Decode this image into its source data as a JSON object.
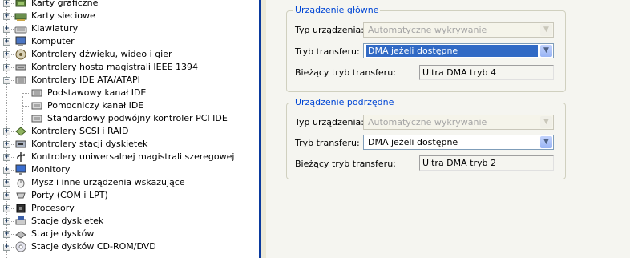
{
  "tree": {
    "items": [
      {
        "label": "Karty graficzne",
        "icon": "display-adapter-icon",
        "expander": "+",
        "depth": 0
      },
      {
        "label": "Karty sieciowe",
        "icon": "network-card-icon",
        "expander": "+",
        "depth": 0
      },
      {
        "label": "Klawiatury",
        "icon": "keyboard-icon",
        "expander": "+",
        "depth": 0
      },
      {
        "label": "Komputer",
        "icon": "computer-icon",
        "expander": "+",
        "depth": 0
      },
      {
        "label": "Kontrolery dźwięku, wideo i gier",
        "icon": "sound-icon",
        "expander": "+",
        "depth": 0
      },
      {
        "label": "Kontrolery hosta magistrali IEEE 1394",
        "icon": "ieee1394-icon",
        "expander": "+",
        "depth": 0
      },
      {
        "label": "Kontrolery IDE ATA/ATAPI",
        "icon": "ide-controller-icon",
        "expander": "−",
        "depth": 0
      },
      {
        "label": "Podstawowy kanał IDE",
        "icon": "ide-channel-icon",
        "expander": "",
        "depth": 1
      },
      {
        "label": "Pomocniczy kanał IDE",
        "icon": "ide-channel-icon",
        "expander": "",
        "depth": 1
      },
      {
        "label": "Standardowy podwójny kontroler PCI IDE",
        "icon": "ide-channel-icon",
        "expander": "",
        "depth": 1
      },
      {
        "label": "Kontrolery SCSI i RAID",
        "icon": "scsi-icon",
        "expander": "+",
        "depth": 0
      },
      {
        "label": "Kontrolery stacji dyskietek",
        "icon": "floppy-controller-icon",
        "expander": "+",
        "depth": 0
      },
      {
        "label": "Kontrolery uniwersalnej magistrali szeregowej",
        "icon": "usb-icon",
        "expander": "+",
        "depth": 0
      },
      {
        "label": "Monitory",
        "icon": "monitor-icon",
        "expander": "+",
        "depth": 0
      },
      {
        "label": "Mysz i inne urządzenia wskazujące",
        "icon": "mouse-icon",
        "expander": "+",
        "depth": 0
      },
      {
        "label": "Porty (COM i LPT)",
        "icon": "port-icon",
        "expander": "+",
        "depth": 0
      },
      {
        "label": "Procesory",
        "icon": "processor-icon",
        "expander": "+",
        "depth": 0
      },
      {
        "label": "Stacje dyskietek",
        "icon": "floppy-drive-icon",
        "expander": "+",
        "depth": 0
      },
      {
        "label": "Stacje dysków",
        "icon": "disk-drive-icon",
        "expander": "+",
        "depth": 0
      },
      {
        "label": "Stacje dysków CD-ROM/DVD",
        "icon": "cdrom-icon",
        "expander": "+",
        "depth": 0
      }
    ]
  },
  "primary": {
    "title": "Urządzenie główne",
    "device_type_label": "Typ urządzenia:",
    "device_type_value": "Automatyczne wykrywanie",
    "transfer_mode_label": "Tryb transferu:",
    "transfer_mode_value": "DMA jeżeli dostępne",
    "current_mode_label": "Bieżący tryb transferu:",
    "current_mode_value": "Ultra DMA tryb 4"
  },
  "secondary": {
    "title": "Urządzenie podrzędne",
    "device_type_label": "Typ urządzenia:",
    "device_type_value": "Automatyczne wykrywanie",
    "transfer_mode_label": "Tryb transferu:",
    "transfer_mode_value": "DMA jeżeli dostępne",
    "current_mode_label": "Bieżący tryb transferu:",
    "current_mode_value": "Ultra DMA tryb 2"
  },
  "colors": {
    "group_title": "#0046d5",
    "selection": "#316ac5",
    "splitter": "#0a3a9e"
  }
}
